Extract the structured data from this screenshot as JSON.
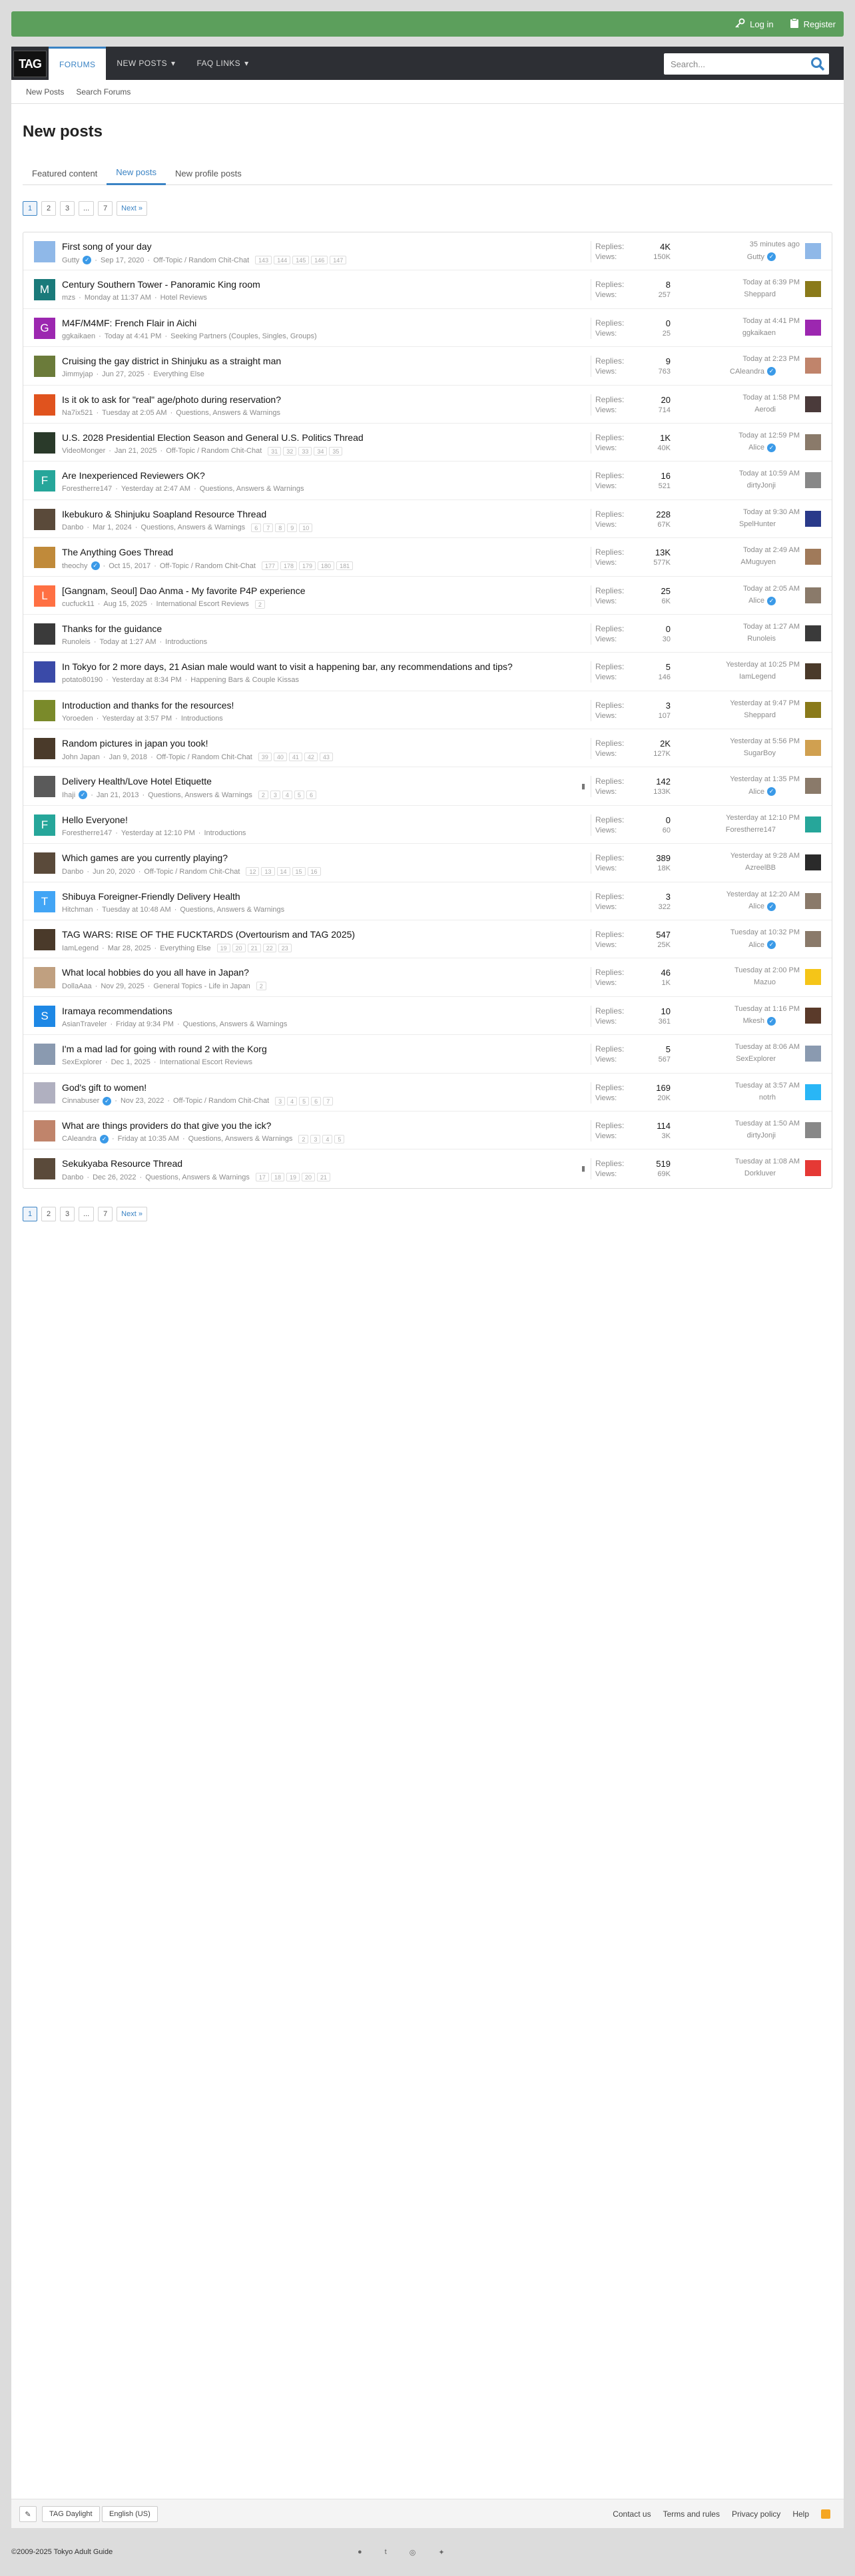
{
  "header": {
    "login_label": "Log in",
    "register_label": "Register"
  },
  "nav": {
    "logo": "TAG",
    "tabs": [
      {
        "label": "FORUMS"
      },
      {
        "label": "NEW POSTS"
      },
      {
        "label": "FAQ LINKS"
      }
    ],
    "search_placeholder": "Search..."
  },
  "subnav": {
    "items": [
      "New Posts",
      "Search Forums"
    ]
  },
  "page": {
    "title": "New posts",
    "tabs": [
      "Featured content",
      "New posts",
      "New profile posts"
    ]
  },
  "pagination": {
    "pages": [
      "1",
      "2",
      "3",
      "...",
      "7"
    ],
    "next_label": "Next »"
  },
  "stat_labels": {
    "replies": "Replies:",
    "views": "Views:"
  },
  "threads": [
    {
      "title": "First song of your day",
      "author": "Gutty",
      "verified": true,
      "date": "Sep 17, 2020",
      "forum": "Off-Topic / Random Chit-Chat",
      "pages": [
        "143",
        "144",
        "145",
        "146",
        "147"
      ],
      "replies": "4K",
      "views": "150K",
      "last_time": "35 minutes ago",
      "last_user": "Gutty",
      "last_verified": true,
      "avatar_letter": "",
      "avatar_color": "#8fb8e8",
      "last_avatar_color": "#8fb8e8"
    },
    {
      "title": "Century Southern Tower - Panoramic King room",
      "author": "mzs",
      "verified": false,
      "date": "Monday at 11:37 AM",
      "forum": "Hotel Reviews",
      "pages": [],
      "replies": "8",
      "views": "257",
      "last_time": "Today at 6:39 PM",
      "last_user": "Sheppard",
      "last_verified": false,
      "avatar_letter": "M",
      "avatar_color": "#1a7a7a",
      "last_avatar_color": "#8a7a1a"
    },
    {
      "title": "M4F/M4MF: French Flair in Aichi",
      "author": "ggkaikaen",
      "verified": false,
      "date": "Today at 4:41 PM",
      "forum": "Seeking Partners (Couples, Singles, Groups)",
      "pages": [],
      "replies": "0",
      "views": "25",
      "last_time": "Today at 4:41 PM",
      "last_user": "ggkaikaen",
      "last_verified": false,
      "avatar_letter": "G",
      "avatar_color": "#9c27b0",
      "last_avatar_color": "#9c27b0"
    },
    {
      "title": "Cruising the gay district in Shinjuku as a straight man",
      "author": "Jimmyjap",
      "verified": false,
      "date": "Jun 27, 2025",
      "forum": "Everything Else",
      "pages": [],
      "replies": "9",
      "views": "763",
      "last_time": "Today at 2:23 PM",
      "last_user": "CAleandra",
      "last_verified": true,
      "avatar_letter": "",
      "avatar_color": "#6b7b3a",
      "last_avatar_color": "#c0846b"
    },
    {
      "title": "Is it ok to ask for \"real\" age/photo during reservation?",
      "author": "Na7ix521",
      "verified": false,
      "date": "Tuesday at 2:05 AM",
      "forum": "Questions, Answers & Warnings",
      "pages": [],
      "replies": "20",
      "views": "714",
      "last_time": "Today at 1:58 PM",
      "last_user": "Aerodi",
      "last_verified": false,
      "avatar_letter": "",
      "avatar_color": "#e0531e",
      "last_avatar_color": "#4a3a3a"
    },
    {
      "title": "U.S. 2028 Presidential Election Season and General U.S. Politics Thread",
      "author": "VideoMonger",
      "verified": false,
      "date": "Jan 21, 2025",
      "forum": "Off-Topic / Random Chit-Chat",
      "pages": [
        "31",
        "32",
        "33",
        "34",
        "35"
      ],
      "replies": "1K",
      "views": "40K",
      "last_time": "Today at 12:59 PM",
      "last_user": "Alice",
      "last_verified": true,
      "avatar_letter": "",
      "avatar_color": "#2a3a2a",
      "last_avatar_color": "#8a7a6a"
    },
    {
      "title": "Are Inexperienced Reviewers OK?",
      "author": "Forestherre147",
      "verified": false,
      "date": "Yesterday at 2:47 AM",
      "forum": "Questions, Answers & Warnings",
      "pages": [],
      "replies": "16",
      "views": "521",
      "last_time": "Today at 10:59 AM",
      "last_user": "dirtyJonji",
      "last_verified": false,
      "avatar_letter": "F",
      "avatar_color": "#26a69a",
      "last_avatar_color": "#888888"
    },
    {
      "title": "Ikebukuro & Shinjuku Soapland Resource Thread",
      "author": "Danbo",
      "verified": false,
      "date": "Mar 1, 2024",
      "forum": "Questions, Answers & Warnings",
      "pages": [
        "6",
        "7",
        "8",
        "9",
        "10"
      ],
      "replies": "228",
      "views": "67K",
      "last_time": "Today at 9:30 AM",
      "last_user": "SpelHunter",
      "last_verified": false,
      "avatar_letter": "",
      "avatar_color": "#5a4a3a",
      "last_avatar_color": "#2a3a8a"
    },
    {
      "title": "The Anything Goes Thread",
      "author": "theochy",
      "verified": true,
      "date": "Oct 15, 2017",
      "forum": "Off-Topic / Random Chit-Chat",
      "pages": [
        "177",
        "178",
        "179",
        "180",
        "181"
      ],
      "replies": "13K",
      "views": "577K",
      "last_time": "Today at 2:49 AM",
      "last_user": "AMuguyen",
      "last_verified": false,
      "avatar_letter": "",
      "avatar_color": "#c08a3a",
      "last_avatar_color": "#a07a5a"
    },
    {
      "title": "[Gangnam, Seoul] Dao Anma - My favorite P4P experience",
      "author": "cucfuck11",
      "verified": false,
      "date": "Aug 15, 2025",
      "forum": "International Escort Reviews",
      "pages": [
        "2"
      ],
      "replies": "25",
      "views": "6K",
      "last_time": "Today at 2:05 AM",
      "last_user": "Alice",
      "last_verified": true,
      "avatar_letter": "L",
      "avatar_color": "#ff7043",
      "last_avatar_color": "#8a7a6a"
    },
    {
      "title": "Thanks for the guidance",
      "author": "Runoleis",
      "verified": false,
      "date": "Today at 1:27 AM",
      "forum": "Introductions",
      "pages": [],
      "replies": "0",
      "views": "30",
      "last_time": "Today at 1:27 AM",
      "last_user": "Runoleis",
      "last_verified": false,
      "avatar_letter": "",
      "avatar_color": "#3a3a3a",
      "last_avatar_color": "#3a3a3a"
    },
    {
      "title": "In Tokyo for 2 more days, 21 Asian male would want to visit a happening bar, any recommendations and tips?",
      "author": "potato80190",
      "verified": false,
      "date": "Yesterday at 8:34 PM",
      "forum": "Happening Bars & Couple Kissas",
      "pages": [],
      "replies": "5",
      "views": "146",
      "last_time": "Yesterday at 10:25 PM",
      "last_user": "IamLegend",
      "last_verified": false,
      "avatar_letter": "",
      "avatar_color": "#3a4aa8",
      "last_avatar_color": "#4a3a2a"
    },
    {
      "title": "Introduction and thanks for the resources!",
      "author": "Yoroeden",
      "verified": false,
      "date": "Yesterday at 3:57 PM",
      "forum": "Introductions",
      "pages": [],
      "replies": "3",
      "views": "107",
      "last_time": "Yesterday at 9:47 PM",
      "last_user": "Sheppard",
      "last_verified": false,
      "avatar_letter": "",
      "avatar_color": "#7a8a2a",
      "last_avatar_color": "#8a7a1a"
    },
    {
      "title": "Random pictures in japan you took!",
      "author": "John Japan",
      "verified": false,
      "date": "Jan 9, 2018",
      "forum": "Off-Topic / Random Chit-Chat",
      "pages": [
        "39",
        "40",
        "41",
        "42",
        "43"
      ],
      "replies": "2K",
      "views": "127K",
      "last_time": "Yesterday at 5:56 PM",
      "last_user": "SugarBoy",
      "last_verified": false,
      "avatar_letter": "",
      "avatar_color": "#4a3a2a",
      "last_avatar_color": "#d0a050"
    },
    {
      "title": "Delivery Health/Love Hotel Etiquette",
      "author": "Ihaji",
      "verified": true,
      "date": "Jan 21, 2013",
      "forum": "Questions, Answers & Warnings",
      "pages": [
        "2",
        "3",
        "4",
        "5",
        "6"
      ],
      "replies": "142",
      "views": "133K",
      "last_time": "Yesterday at 1:35 PM",
      "last_user": "Alice",
      "last_verified": true,
      "avatar_letter": "",
      "avatar_color": "#5a5a5a",
      "last_avatar_color": "#8a7a6a",
      "pinned": true
    },
    {
      "title": "Hello Everyone!",
      "author": "Forestherre147",
      "verified": false,
      "date": "Yesterday at 12:10 PM",
      "forum": "Introductions",
      "pages": [],
      "replies": "0",
      "views": "60",
      "last_time": "Yesterday at 12:10 PM",
      "last_user": "Forestherre147",
      "last_verified": false,
      "avatar_letter": "F",
      "avatar_color": "#26a69a",
      "last_avatar_color": "#26a69a"
    },
    {
      "title": "Which games are you currently playing?",
      "author": "Danbo",
      "verified": false,
      "date": "Jun 20, 2020",
      "forum": "Off-Topic / Random Chit-Chat",
      "pages": [
        "12",
        "13",
        "14",
        "15",
        "16"
      ],
      "replies": "389",
      "views": "18K",
      "last_time": "Yesterday at 9:28 AM",
      "last_user": "AzreelBB",
      "last_verified": false,
      "avatar_letter": "",
      "avatar_color": "#5a4a3a",
      "last_avatar_color": "#2a2a2a"
    },
    {
      "title": "Shibuya Foreigner-Friendly Delivery Health",
      "author": "Hitchman",
      "verified": false,
      "date": "Tuesday at 10:48 AM",
      "forum": "Questions, Answers & Warnings",
      "pages": [],
      "replies": "3",
      "views": "322",
      "last_time": "Yesterday at 12:20 AM",
      "last_user": "Alice",
      "last_verified": true,
      "avatar_letter": "T",
      "avatar_color": "#42a5f5",
      "last_avatar_color": "#8a7a6a"
    },
    {
      "title": "TAG WARS: RISE OF THE FUCKTARDS (Overtourism and TAG 2025)",
      "author": "IamLegend",
      "verified": false,
      "date": "Mar 28, 2025",
      "forum": "Everything Else",
      "pages": [
        "19",
        "20",
        "21",
        "22",
        "23"
      ],
      "replies": "547",
      "views": "25K",
      "last_time": "Tuesday at 10:32 PM",
      "last_user": "Alice",
      "last_verified": true,
      "avatar_letter": "",
      "avatar_color": "#4a3a2a",
      "last_avatar_color": "#8a7a6a"
    },
    {
      "title": "What local hobbies do you all have in Japan?",
      "author": "DollaAaa",
      "verified": false,
      "date": "Nov 29, 2025",
      "forum": "General Topics - Life in Japan",
      "pages": [
        "2"
      ],
      "replies": "46",
      "views": "1K",
      "last_time": "Tuesday at 2:00 PM",
      "last_user": "Mazuo",
      "last_verified": false,
      "avatar_letter": "",
      "avatar_color": "#c0a080",
      "last_avatar_color": "#f5c518"
    },
    {
      "title": "Iramaya recommendations",
      "author": "AsianTraveler",
      "verified": false,
      "date": "Friday at 9:34 PM",
      "forum": "Questions, Answers & Warnings",
      "pages": [],
      "replies": "10",
      "views": "361",
      "last_time": "Tuesday at 1:16 PM",
      "last_user": "Mkesh",
      "last_verified": true,
      "avatar_letter": "S",
      "avatar_color": "#1e88e5",
      "last_avatar_color": "#5a3a2a"
    },
    {
      "title": "I'm a mad lad for going with round 2 with the Korg",
      "author": "SexExplorer",
      "verified": false,
      "date": "Dec 1, 2025",
      "forum": "International Escort Reviews",
      "pages": [],
      "replies": "5",
      "views": "567",
      "last_time": "Tuesday at 8:06 AM",
      "last_user": "SexExplorer",
      "last_verified": false,
      "avatar_letter": "",
      "avatar_color": "#8a9ab0",
      "last_avatar_color": "#8a9ab0"
    },
    {
      "title": "God's gift to women!",
      "author": "Cinnabuser",
      "verified": true,
      "date": "Nov 23, 2022",
      "forum": "Off-Topic / Random Chit-Chat",
      "pages": [
        "3",
        "4",
        "5",
        "6",
        "7"
      ],
      "replies": "169",
      "views": "20K",
      "last_time": "Tuesday at 3:57 AM",
      "last_user": "notrh",
      "last_verified": false,
      "avatar_letter": "",
      "avatar_color": "#b0b0c0",
      "last_avatar_color": "#29b6f6"
    },
    {
      "title": "What are things providers do that give you the ick?",
      "author": "CAleandra",
      "verified": true,
      "date": "Friday at 10:35 AM",
      "forum": "Questions, Answers & Warnings",
      "pages": [
        "2",
        "3",
        "4",
        "5"
      ],
      "replies": "114",
      "views": "3K",
      "last_time": "Tuesday at 1:50 AM",
      "last_user": "dirtyJonji",
      "last_verified": false,
      "avatar_letter": "",
      "avatar_color": "#c0846b",
      "last_avatar_color": "#888888"
    },
    {
      "title": "Sekukyaba Resource Thread",
      "author": "Danbo",
      "verified": false,
      "date": "Dec 26, 2022",
      "forum": "Questions, Answers & Warnings",
      "pages": [
        "17",
        "18",
        "19",
        "20",
        "21"
      ],
      "replies": "519",
      "views": "69K",
      "last_time": "Tuesday at 1:08 AM",
      "last_user": "Dorkluver",
      "last_verified": false,
      "avatar_letter": "",
      "avatar_color": "#5a4a3a",
      "last_avatar_color": "#e53935",
      "pinned": true
    }
  ],
  "footer": {
    "style_label": "TAG Daylight",
    "language_label": "English (US)",
    "links": [
      "Contact us",
      "Terms and rules",
      "Privacy policy",
      "Help"
    ],
    "copyright": "©2009-2025 Tokyo Adult Guide"
  }
}
